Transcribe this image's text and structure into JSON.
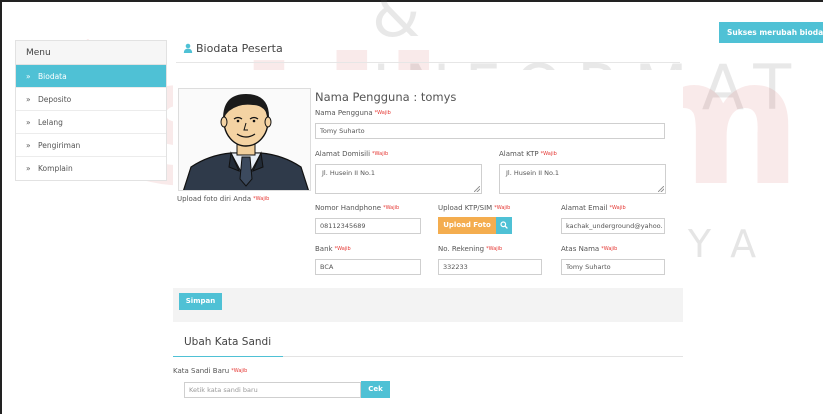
{
  "watermark": {
    "main": "stikom",
    "top": "& INFORMAT",
    "bottom": "SURABAYA"
  },
  "toast": {
    "message": "Sukses merubah biodata"
  },
  "sidebar": {
    "header": "Menu",
    "items": [
      {
        "label": "Biodata",
        "active": true
      },
      {
        "label": "Deposito"
      },
      {
        "label": "Lelang"
      },
      {
        "label": "Pengiriman"
      },
      {
        "label": "Komplain"
      }
    ],
    "chevron": "»"
  },
  "page": {
    "title": "Biodata Peserta",
    "title_icon": "user-icon"
  },
  "photo": {
    "caption": "Upload foto diri Anda",
    "required": "*Wajib"
  },
  "form": {
    "heading": "Nama Pengguna : tomys",
    "required_text": "*Wajib",
    "username": {
      "label": "Nama Pengguna",
      "value": "Tomy Suharto"
    },
    "alamat_domisili": {
      "label": "Alamat Domisili",
      "value": "Jl. Husein II No.1"
    },
    "alamat_ktp": {
      "label": "Alamat KTP",
      "value": "Jl. Husein II No.1"
    },
    "phone": {
      "label": "Nomor Handphone",
      "value": "08112345689"
    },
    "upload_ktp": {
      "label": "Upload KTP/SIM",
      "button": "Upload Foto",
      "icon": "search-icon"
    },
    "email": {
      "label": "Alamat Email",
      "value": "kachak_underground@yahoo."
    },
    "bank": {
      "label": "Bank",
      "value": "BCA"
    },
    "rekening": {
      "label": "No. Rekening",
      "value": "332233"
    },
    "atas_nama": {
      "label": "Atas Nama",
      "value": "Tomy Suharto"
    },
    "submit": "Simpan"
  },
  "password": {
    "title": "Ubah Kata Sandi",
    "label": "Kata Sandi Baru",
    "required_text": "*Wajib",
    "placeholder": "Ketik kata sandi baru",
    "button": "Cek"
  }
}
